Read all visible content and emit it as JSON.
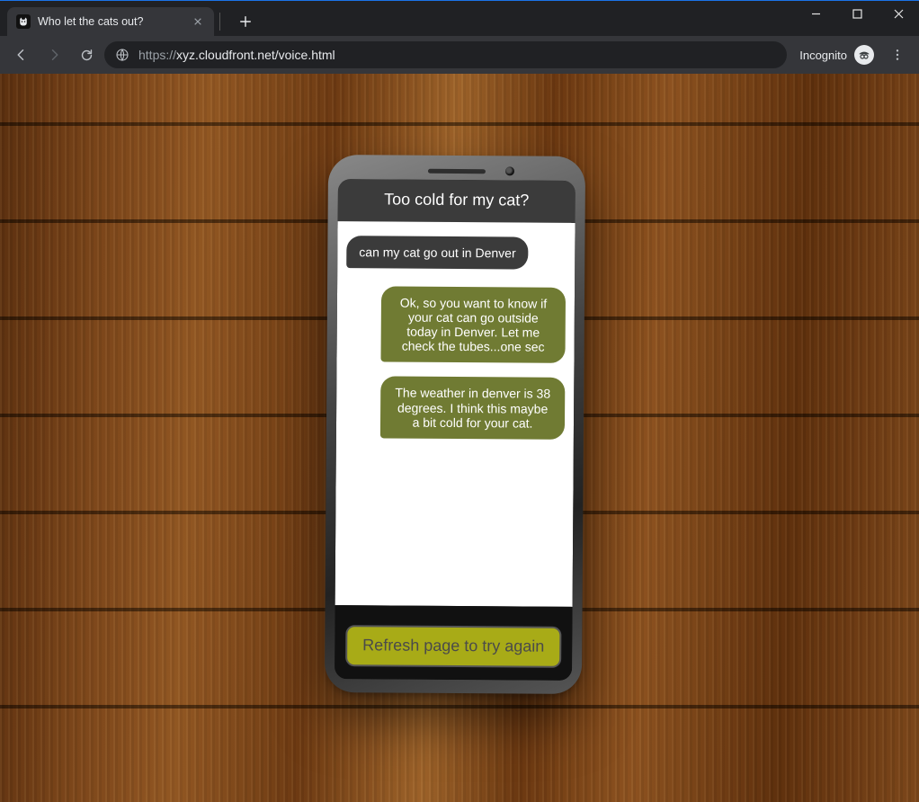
{
  "browser": {
    "tab_title": "Who let the cats out?",
    "new_tab_tooltip": "New tab",
    "url_scheme": "https://",
    "url_rest": "xyz.cloudfront.net/voice.html",
    "incognito_label": "Incognito"
  },
  "app": {
    "header_title": "Too cold for my cat?",
    "messages": [
      {
        "role": "user",
        "text": "can my cat go out in Denver"
      },
      {
        "role": "bot",
        "text": "Ok, so you want to know if your cat can go outside today in Denver. Let me check the tubes...one sec"
      },
      {
        "role": "bot",
        "text": "The weather in denver is 38 degrees. I think this maybe a bit cold for your cat."
      }
    ],
    "refresh_button_label": "Refresh page to try again"
  },
  "colors": {
    "bot_bubble": "#707b33",
    "user_bubble": "#3b3b3b",
    "refresh_button": "#a8ab17"
  }
}
